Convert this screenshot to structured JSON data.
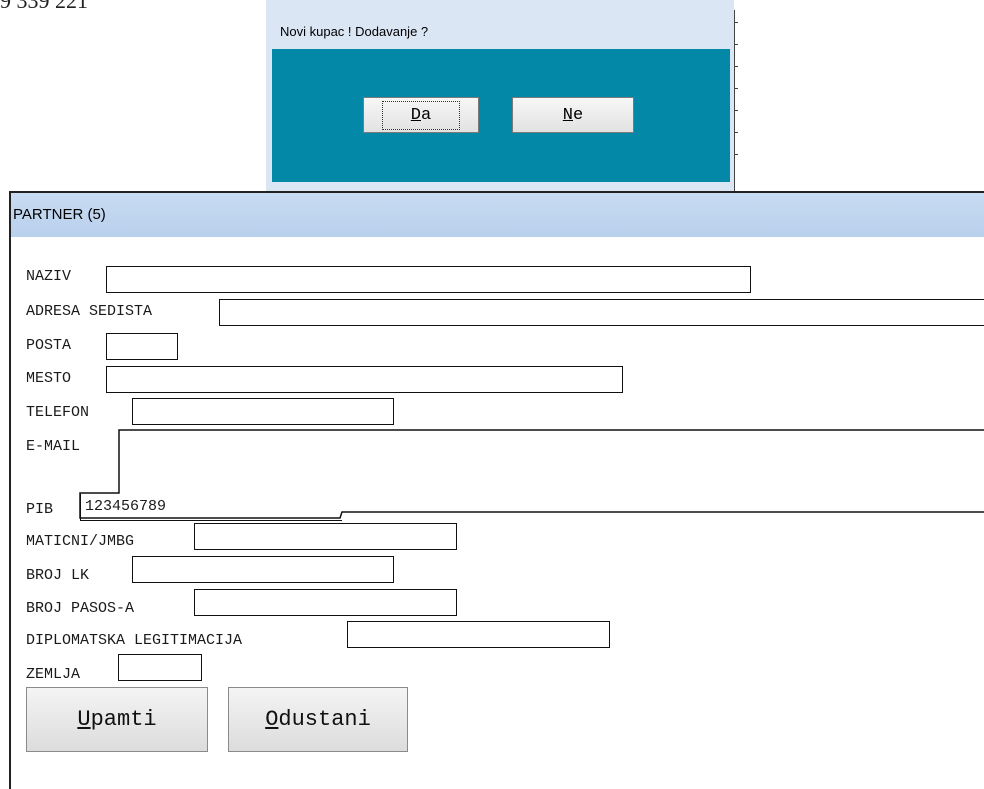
{
  "background_text": "9 339 221",
  "dialog": {
    "title": "Novi kupac ! Dodavanje ?",
    "yes_button": {
      "accel": "D",
      "rest": "a"
    },
    "no_button": {
      "accel": "N",
      "rest": "e"
    }
  },
  "window": {
    "title": "PARTNER (5)",
    "fields": {
      "naziv": {
        "label": "NAZIV",
        "value": ""
      },
      "adresa": {
        "label": "ADRESA SEDISTA",
        "value": ""
      },
      "posta": {
        "label": "POSTA",
        "value": ""
      },
      "mesto": {
        "label": "MESTO",
        "value": ""
      },
      "telefon": {
        "label": "TELEFON",
        "value": ""
      },
      "email": {
        "label": "E-MAIL",
        "value": ""
      },
      "pib": {
        "label": "PIB",
        "value": "123456789"
      },
      "maticni": {
        "label": "MATICNI/JMBG",
        "value": ""
      },
      "broj_lk": {
        "label": "BROJ LK",
        "value": ""
      },
      "pasos": {
        "label": "BROJ PASOS-A",
        "value": ""
      },
      "diplomatska": {
        "label": "DIPLOMATSKA LEGITIMACIJA",
        "value": ""
      },
      "zemlja": {
        "label": "ZEMLJA",
        "value": ""
      }
    },
    "save_button": {
      "accel": "U",
      "rest": "pamti"
    },
    "cancel_button": {
      "accel": "O",
      "rest": "dustani"
    }
  }
}
